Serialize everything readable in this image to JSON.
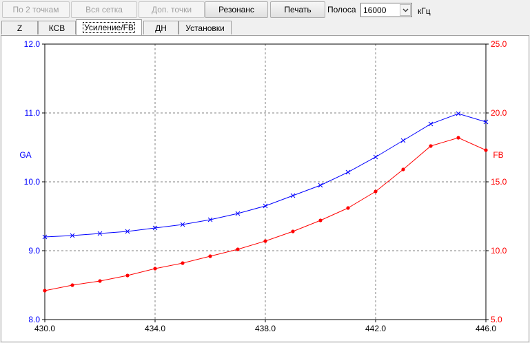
{
  "toolbar": {
    "btn_two_points": "По 2 точкам",
    "btn_all_grid": "Вся сетка",
    "btn_extra_points": "Доп. точки",
    "btn_resonance": "Резонанс",
    "btn_print": "Печать",
    "band_label": "Полоса",
    "band_value": "16000",
    "unit_label": "кГц"
  },
  "tabs": [
    {
      "label": "Z"
    },
    {
      "label": "КСВ"
    },
    {
      "label": "Усиление/FB"
    },
    {
      "label": "ДН"
    },
    {
      "label": "Установки"
    }
  ],
  "chart_data": {
    "type": "line",
    "xlim": [
      430.0,
      446.0
    ],
    "x_ticks": [
      "430.0",
      "434.0",
      "438.0",
      "442.0",
      "446.0"
    ],
    "left_axis": {
      "label": "GA",
      "ylim": [
        8.0,
        12.0
      ],
      "ticks": [
        "8.0",
        "9.0",
        "10.0",
        "11.0",
        "12.0"
      ],
      "color": "#0000ff"
    },
    "right_axis": {
      "label": "FB",
      "ylim": [
        5.0,
        25.0
      ],
      "ticks": [
        "5.0",
        "10.0",
        "15.0",
        "20.0",
        "25.0"
      ],
      "color": "#ff0000"
    },
    "grid": true,
    "x": [
      430,
      431,
      432,
      433,
      434,
      435,
      436,
      437,
      438,
      439,
      440,
      441,
      442,
      443,
      444,
      445,
      446
    ],
    "series": [
      {
        "name": "GA",
        "axis": "left",
        "color": "#0000ff",
        "marker": "x",
        "values": [
          9.2,
          9.22,
          9.25,
          9.28,
          9.33,
          9.38,
          9.45,
          9.54,
          9.65,
          9.8,
          9.95,
          10.14,
          10.36,
          10.6,
          10.84,
          10.99,
          10.87
        ]
      },
      {
        "name": "FB",
        "axis": "right",
        "color": "#ff0000",
        "marker": "dot",
        "values": [
          7.1,
          7.5,
          7.8,
          8.2,
          8.7,
          9.1,
          9.6,
          10.1,
          10.7,
          11.4,
          12.2,
          13.1,
          14.3,
          15.9,
          17.6,
          18.2,
          17.3
        ]
      }
    ]
  }
}
